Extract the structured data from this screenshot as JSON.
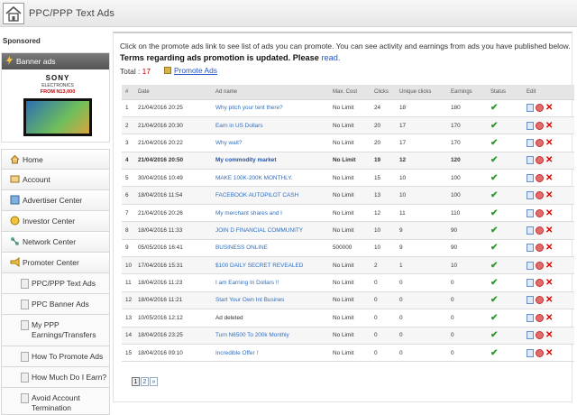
{
  "header": {
    "title": "PPC/PPP Text Ads"
  },
  "sidebar": {
    "sponsored": "Sponsored",
    "banner_title": "Banner ads",
    "banner_ad": {
      "brand": "SONY",
      "sub": "ELECTRONICS",
      "price": "FROM N13,000"
    },
    "menu": [
      {
        "label": "Home",
        "icon": "home-icon"
      },
      {
        "label": "Account",
        "icon": "account-icon"
      },
      {
        "label": "Advertiser Center",
        "icon": "advertiser-icon"
      },
      {
        "label": "Investor Center",
        "icon": "investor-icon"
      },
      {
        "label": "Network Center",
        "icon": "network-icon"
      },
      {
        "label": "Promoter Center",
        "icon": "promoter-icon"
      }
    ],
    "submenu": [
      "PPC/PPP Text Ads",
      "PPC Banner Ads",
      "My PPP Earnings/Transfers",
      "How To Promote Ads",
      "How Much Do I Earn?",
      "Avoid Account Termination"
    ]
  },
  "main": {
    "intro": "Click on the promote ads link to see list of ads you can promote. You can see activity and earnings from ads you have published below.",
    "terms": "Terms regarding ads promotion is updated. Please",
    "terms_link": "read.",
    "total_label": "Total :",
    "total_value": "17",
    "promote_link": "Promote Ads",
    "columns": [
      "#",
      "Date",
      "Ad name",
      "Max. Cost",
      "Clicks",
      "Unique clicks",
      "Earnings",
      "Status",
      "Edit"
    ],
    "rows": [
      {
        "n": "1",
        "date": "21/04/2016 20:25",
        "name": "Why pitch your tent there?",
        "cost": "No Limit",
        "clicks": "24",
        "unique": "18",
        "earn": "180"
      },
      {
        "n": "2",
        "date": "21/04/2016 20:30",
        "name": "Earn in US Dollars",
        "cost": "No Limit",
        "clicks": "20",
        "unique": "17",
        "earn": "170"
      },
      {
        "n": "3",
        "date": "21/04/2016 20:22",
        "name": "Why wait?",
        "cost": "No Limit",
        "clicks": "20",
        "unique": "17",
        "earn": "170"
      },
      {
        "n": "4",
        "date": "21/04/2016 20:50",
        "name": "My commodity market",
        "cost": "No Limit",
        "clicks": "19",
        "unique": "12",
        "earn": "120"
      },
      {
        "n": "5",
        "date": "30/04/2016 10:49",
        "name": "MAKE 100K-200K MONTHLY.",
        "cost": "No Limit",
        "clicks": "15",
        "unique": "10",
        "earn": "100"
      },
      {
        "n": "6",
        "date": "18/04/2016 11:54",
        "name": "FACEBOOK AUTOPILOT CASH",
        "cost": "No Limit",
        "clicks": "13",
        "unique": "10",
        "earn": "100"
      },
      {
        "n": "7",
        "date": "21/04/2016 20:26",
        "name": "My merchant shares and I",
        "cost": "No Limit",
        "clicks": "12",
        "unique": "11",
        "earn": "110"
      },
      {
        "n": "8",
        "date": "18/04/2016 11:33",
        "name": "JOIN D FINANCIAL COMMUNITY",
        "cost": "No Limit",
        "clicks": "10",
        "unique": "9",
        "earn": "90"
      },
      {
        "n": "9",
        "date": "05/05/2016 16:41",
        "name": "BUSINESS ONLINE",
        "cost": "500000",
        "clicks": "10",
        "unique": "9",
        "earn": "90"
      },
      {
        "n": "10",
        "date": "17/04/2016 15:31",
        "name": "$100 DAILY SECRET REVEALED",
        "cost": "No Limit",
        "clicks": "2",
        "unique": "1",
        "earn": "10"
      },
      {
        "n": "11",
        "date": "18/04/2016 11:23",
        "name": "I am Earning In Dollars !!",
        "cost": "No Limit",
        "clicks": "0",
        "unique": "0",
        "earn": "0"
      },
      {
        "n": "12",
        "date": "18/04/2016 11:21",
        "name": "Start Your Own Int Busines",
        "cost": "No Limit",
        "clicks": "0",
        "unique": "0",
        "earn": "0"
      },
      {
        "n": "13",
        "date": "10/05/2016 12:12",
        "name": "Ad deleted",
        "cost": "No Limit",
        "clicks": "0",
        "unique": "0",
        "earn": "0"
      },
      {
        "n": "14",
        "date": "18/04/2016 23:25",
        "name": "Turn N6500 To 200k Monthly",
        "cost": "No Limit",
        "clicks": "0",
        "unique": "0",
        "earn": "0"
      },
      {
        "n": "15",
        "date": "18/04/2016 09:10",
        "name": "Incredible Offer !",
        "cost": "No Limit",
        "clicks": "0",
        "unique": "0",
        "earn": "0"
      }
    ],
    "bold_row": "4",
    "plain_name_row": "13",
    "pager": [
      "1",
      "2",
      "»"
    ]
  },
  "colors": {
    "link": "#2f6fc0",
    "status_ok": "#2a9a2a",
    "delete": "#dd0000",
    "total": "#cc0000"
  }
}
